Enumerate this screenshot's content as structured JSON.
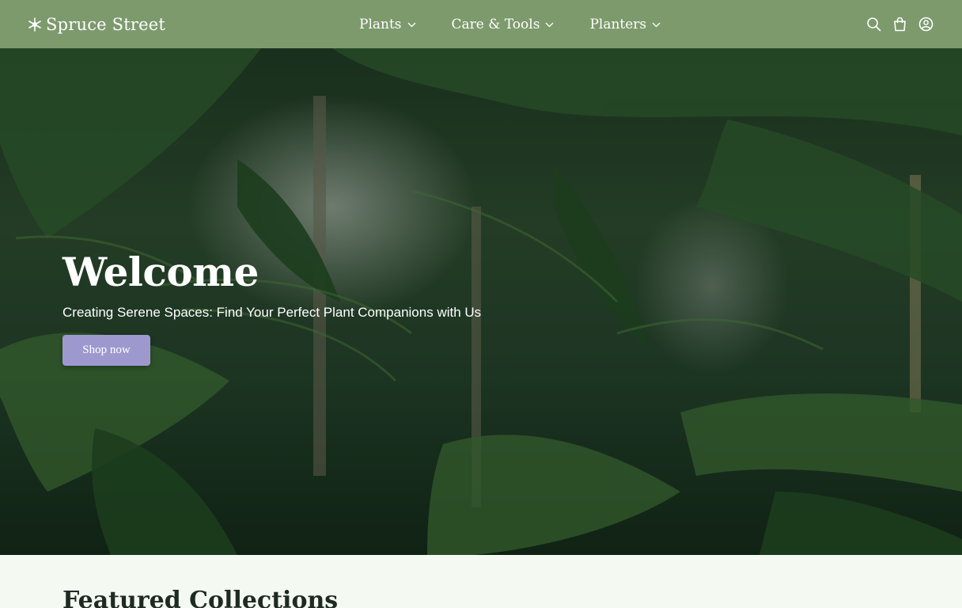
{
  "brand": {
    "name": "Spruce Street",
    "logo_icon": "leaf-snowflake-icon"
  },
  "nav": {
    "items": [
      {
        "label": "Plants",
        "icon": "chevron-down-icon"
      },
      {
        "label": "Care & Tools",
        "icon": "chevron-down-icon"
      },
      {
        "label": "Planters",
        "icon": "chevron-down-icon"
      }
    ]
  },
  "header_icons": [
    "search-icon",
    "shopping-bag-icon",
    "account-icon"
  ],
  "hero": {
    "title": "Welcome",
    "subtitle": "Creating Serene Spaces: Find Your Perfect Plant Companions with Us",
    "button_label": "Shop now",
    "background": "tropical-foliage-image"
  },
  "featured": {
    "title": "Featured Collections"
  },
  "colors": {
    "header_bg": "#7d9a6d",
    "button_bg": "#9d99cf",
    "page_bg": "#f4f9f1",
    "text_light": "#ffffff",
    "text_dark": "#1f2a22"
  }
}
